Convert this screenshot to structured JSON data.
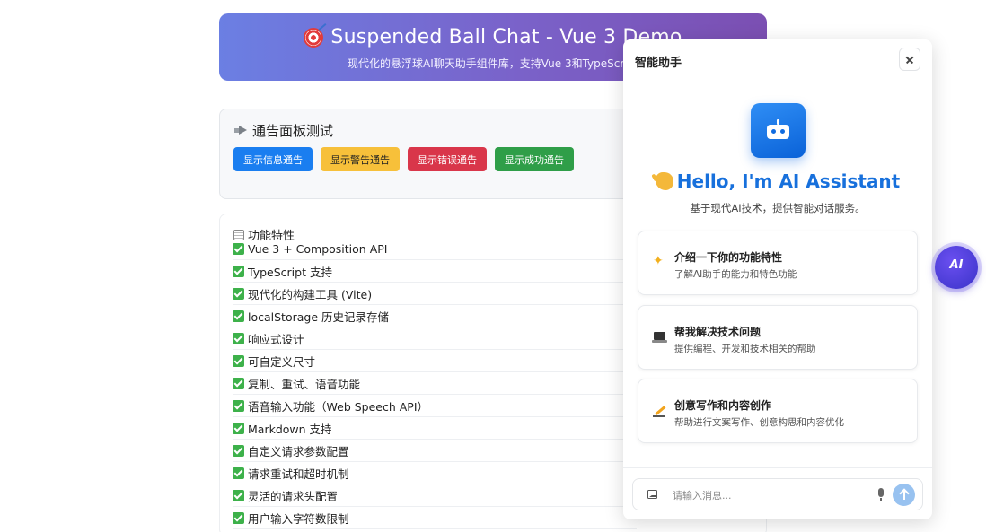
{
  "banner": {
    "title": "Suspended Ball Chat - Vue 3 Demo",
    "subtitle": "现代化的悬浮球AI聊天助手组件库，支持Vue 3和TypeScript"
  },
  "notice": {
    "title": "通告面板测试",
    "buttons": [
      {
        "label": "显示信息通告",
        "color": "#1a7ef0"
      },
      {
        "label": "显示警告通告",
        "color": "#f7c03a"
      },
      {
        "label": "显示错误通告",
        "color": "#d9364a"
      },
      {
        "label": "显示成功通告",
        "color": "#2f9e48"
      }
    ]
  },
  "features": {
    "title": "功能特性",
    "items": [
      "Vue 3 + Composition API",
      "TypeScript 支持",
      "现代化的构建工具 (Vite)",
      "localStorage 历史记录存储",
      "响应式设计",
      "可自定义尺寸",
      "复制、重试、语音功能",
      "语音输入功能（Web Speech API）",
      "Markdown 支持",
      "自定义请求参数配置",
      "请求重试和超时机制",
      "灵活的请求头配置",
      "用户输入字符数限制"
    ]
  },
  "chat": {
    "title": "智能助手",
    "hello": "Hello, I'm AI Assistant",
    "hello_sub": "基于现代AI技术，提供智能对话服务。",
    "suggestions": [
      {
        "icon": "sparkle-icon",
        "title": "介绍一下你的功能特性",
        "desc": "了解AI助手的能力和特色功能"
      },
      {
        "icon": "laptop-icon",
        "title": "帮我解决技术问题",
        "desc": "提供编程、开发和技术相关的帮助"
      },
      {
        "icon": "pen-icon",
        "title": "创意写作和内容创作",
        "desc": "帮助进行文案写作、创意构思和内容优化"
      }
    ],
    "input": {
      "placeholder": "请输入消息...",
      "value": ""
    }
  },
  "float_ball": {
    "label": "AI"
  }
}
